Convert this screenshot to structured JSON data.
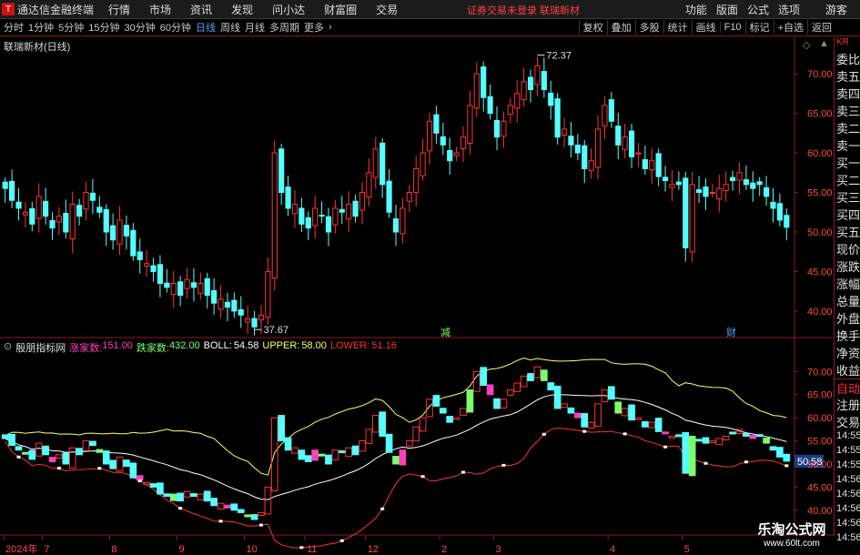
{
  "app": {
    "title": "通达信金融终端",
    "logo_char": "T"
  },
  "menu": [
    "行情",
    "市场",
    "资讯",
    "发现",
    "问小达",
    "财富圈",
    "交易"
  ],
  "notice": "证券交易未登录 联瑞新材",
  "menu_right": [
    "功能",
    "版面",
    "公式",
    "选项",
    "游客"
  ],
  "periods": [
    "分时",
    "1分钟",
    "5分钟",
    "15分钟",
    "30分钟",
    "60分钟",
    "日线",
    "周线",
    "月线",
    "多周期",
    "更多"
  ],
  "active_period": "日线",
  "tools": [
    "复权",
    "叠加",
    "多股",
    "统计",
    "画线",
    "F10",
    "标记",
    "+自选",
    "返回"
  ],
  "main_title": "联瑞新材(日线)",
  "main_axis": [
    "70.00",
    "65.00",
    "60.00",
    "55.00",
    "50.00",
    "45.00",
    "40.00"
  ],
  "main_hi_label": "72.37",
  "main_lo_label": "37.67",
  "event_labels": [
    "减",
    "财"
  ],
  "ind": {
    "name": "殷朋指标网",
    "up_label": "涨家数:",
    "up_value": "151.00",
    "down_label": "跌家数:",
    "down_value": "432.00",
    "boll_label": "BOLL:",
    "boll_value": "54.58",
    "upper_label": "UPPER:",
    "upper_value": "58.00",
    "lower_label": "LOWER:",
    "lower_value": "51.16",
    "axis": [
      "70.00",
      "65.00",
      "60.00",
      "55.00",
      "50.00",
      "45.00",
      "40.00"
    ],
    "price_tag": "50.58"
  },
  "dates": [
    "2024年",
    "7",
    "8",
    "9",
    "10",
    "11",
    "12",
    "2",
    "3",
    "4",
    "5"
  ],
  "side_panel": [
    "委比",
    "卖五",
    "卖四",
    "卖三",
    "卖二",
    "卖一",
    "买一",
    "买二",
    "买三",
    "买四",
    "买五",
    "现价",
    "涨跌",
    "涨幅",
    "总量",
    "外盘",
    "换手",
    "净资",
    "收益",
    "自动",
    "注册",
    "交易",
    "14:55",
    "14:55",
    "14:55",
    "14:56",
    "14:56",
    "14:56",
    "14:56",
    "14:56"
  ],
  "stock_code_tag": "KR",
  "watermark": {
    "line1": "乐淘公式网",
    "line2": "www.60lt.com"
  },
  "colors": {
    "up": "#ff3232",
    "down": "#54ffff",
    "mid": "#ffffff",
    "upper": "#ffff66",
    "lower": "#ff3030",
    "accent": "#4aa3ff"
  },
  "chart_data": {
    "type": "candlestick",
    "x": [
      "2024年",
      "7",
      "8",
      "9",
      "10",
      "11",
      "12",
      "2",
      "3",
      "4",
      "5"
    ],
    "close": [
      55.5,
      54.0,
      53.0,
      52.5,
      51.0,
      54.5,
      52.0,
      50.5,
      52.0,
      50.0,
      53.5,
      52.0,
      55.0,
      54.0,
      52.5,
      50.0,
      49.0,
      51.5,
      49.5,
      47.0,
      46.5,
      46.0,
      45.0,
      43.5,
      43.0,
      43.5,
      42.0,
      44.0,
      43.0,
      43.5,
      42.0,
      41.0,
      41.5,
      40.5,
      40.0,
      39.5,
      39.0,
      38.0,
      39.5,
      45.0,
      60.0,
      55.0,
      53.0,
      53.5,
      51.0,
      50.5,
      53.0,
      52.0,
      50.0,
      53.0,
      52.5,
      53.5,
      52.0,
      55.0,
      57.5,
      60.5,
      56.0,
      52.5,
      50.0,
      53.0,
      55.0,
      58.0,
      60.0,
      64.0,
      62.5,
      61.0,
      59.0,
      60.0,
      62.0,
      66.0,
      70.0,
      67.0,
      65.0,
      62.0,
      64.0,
      66.0,
      67.5,
      69.0,
      68.0,
      71.0,
      68.0,
      66.0,
      62.0,
      63.0,
      61.0,
      60.0,
      58.0,
      59.0,
      63.0,
      66.0,
      64.0,
      61.0,
      62.0,
      59.5,
      60.0,
      58.0,
      59.0,
      57.0,
      56.5,
      56.0,
      56.0,
      48.0,
      56.0,
      55.0,
      54.5,
      55.0,
      55.5,
      56.0,
      56.5,
      57.5,
      56.0,
      55.5,
      56.0,
      54.5,
      53.0,
      51.5,
      50.6
    ],
    "hi_label": 72.37,
    "lo_label": 37.67,
    "ylim": [
      37,
      73
    ],
    "indicator": {
      "name": "殷朋指标网",
      "up_count": 151.0,
      "down_count": 432.0,
      "boll": 54.58,
      "upper": 58.0,
      "lower": 51.16,
      "ylim": [
        38,
        73
      ]
    }
  }
}
